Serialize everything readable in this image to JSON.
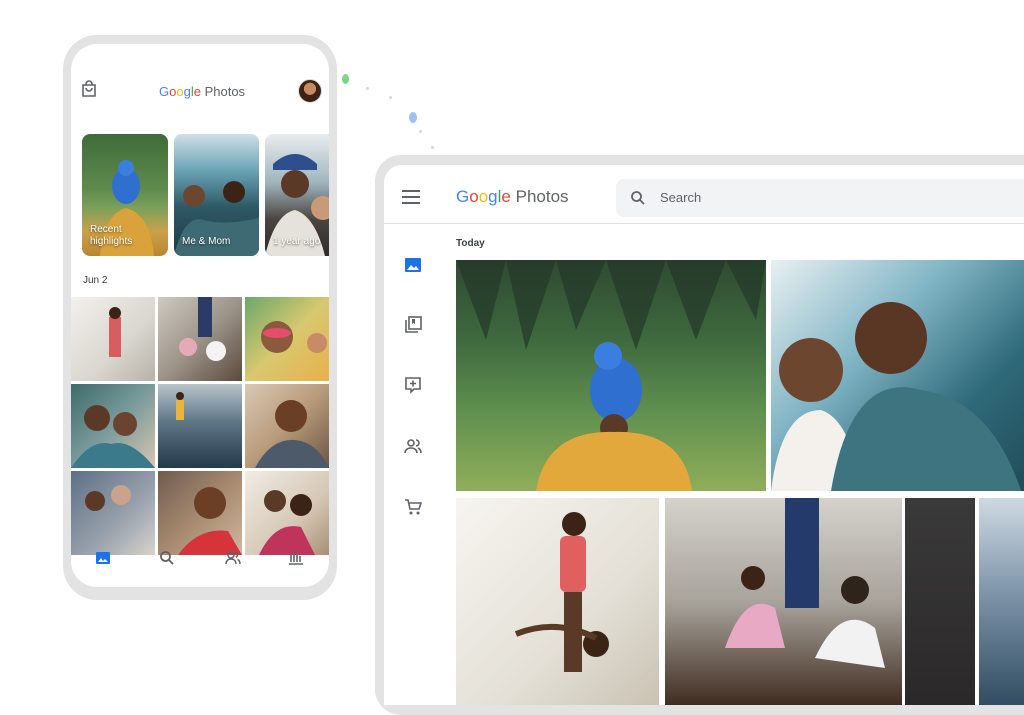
{
  "phone": {
    "logo": {
      "google": [
        "G",
        "o",
        "o",
        "g",
        "l",
        "e"
      ],
      "product": "Photos"
    },
    "highlights": [
      {
        "label": "Recent highlights"
      },
      {
        "label": "Me & Mom"
      },
      {
        "label": "1 year ago"
      }
    ],
    "date_header": "Jun 2",
    "nav_icons": [
      "photos-icon",
      "search-icon",
      "sharing-icon",
      "library-icon"
    ]
  },
  "desktop": {
    "logo": {
      "google": [
        "G",
        "o",
        "o",
        "g",
        "l",
        "e"
      ],
      "product": "Photos"
    },
    "search": {
      "placeholder": "Search"
    },
    "section_title": "Today",
    "sidebar_icons": [
      "photos-icon",
      "albums-icon",
      "for-you-icon",
      "sharing-icon",
      "print-store-icon"
    ]
  },
  "colors": {
    "google_blue": "#4285f4",
    "google_red": "#ea4335",
    "google_yellow": "#fbbc05",
    "google_green": "#34a853",
    "active_icon": "#1a73e8",
    "icon_gray": "#5f6368",
    "frame_gray": "#e3e3e3"
  }
}
